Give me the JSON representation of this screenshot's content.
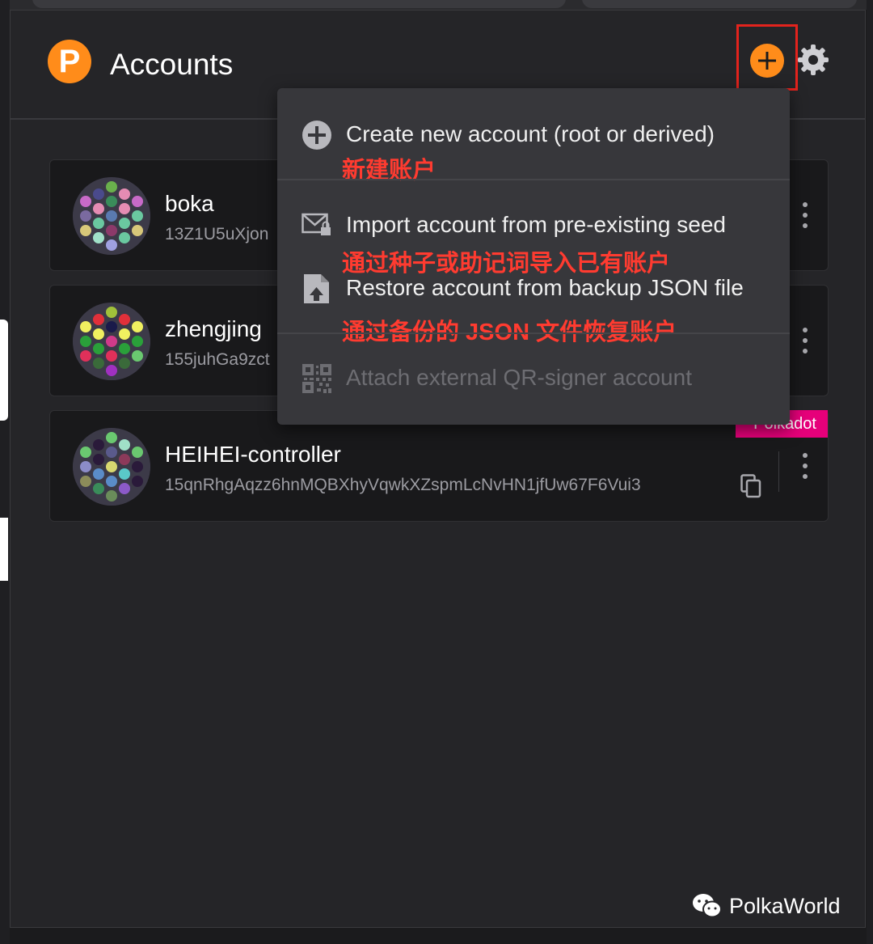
{
  "header": {
    "logo_letter": "P",
    "title": "Accounts"
  },
  "accounts": [
    {
      "name": "boka",
      "address": "13Z1U5uXjon"
    },
    {
      "name": "zhengjing",
      "address": "155juhGa9zct"
    },
    {
      "name": "HEIHEI-controller",
      "address": "15qnRhgAqzz6hnMQBXhyVqwkXZspmLcNvHN1jfUw67F6Vui3",
      "network": "Polkadot"
    }
  ],
  "menu": {
    "items": [
      {
        "label": "Create new account (root or derived)",
        "note": "新建账户",
        "icon": "plus-circle-icon",
        "enabled": true
      },
      {
        "label": "Import account from pre-existing seed",
        "note": "通过种子或助记词导入已有账户",
        "icon": "envelope-lock-icon",
        "enabled": true
      },
      {
        "label": "Restore account from backup JSON file",
        "note": "通过备份的 JSON 文件恢复账户",
        "icon": "file-upload-icon",
        "enabled": true
      },
      {
        "label": "Attach external QR-signer account",
        "icon": "qr-code-icon",
        "enabled": false
      }
    ]
  },
  "watermark": {
    "text": "PolkaWorld",
    "icon": "wechat-icon"
  },
  "colors": {
    "accent": "#ff8c1a",
    "annotation": "#e3231d",
    "network_badge": "#e6007a",
    "background": "#252528"
  }
}
